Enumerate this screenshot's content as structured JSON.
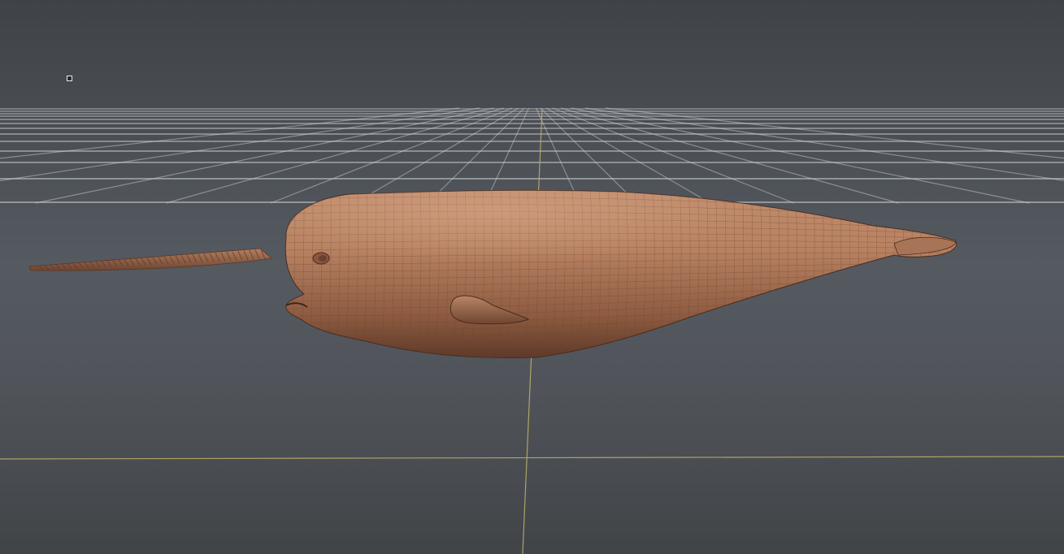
{
  "app": {
    "view": "3d-viewport",
    "shading": "sculpt-clay-wireframe",
    "background": {
      "top": "#3f4348",
      "bottom": "#414447"
    },
    "model": {
      "name": "",
      "material_color": "#b27d5e",
      "wire_color": "#6e4632"
    }
  },
  "colors": {
    "grid": "#d8dadc",
    "axis_x": "#b9ad6a",
    "axis_z": "#b9ad6a"
  },
  "icons": {
    "pivot": "square-handle-icon"
  }
}
